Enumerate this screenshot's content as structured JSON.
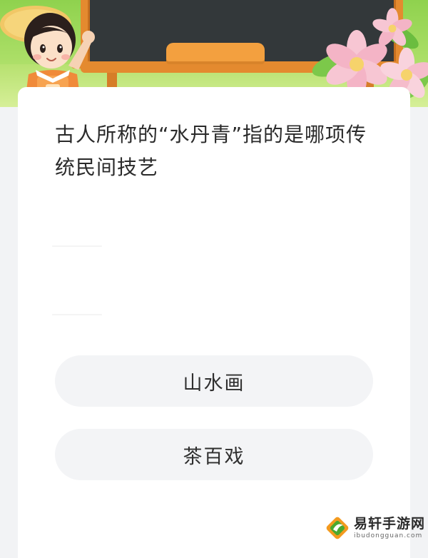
{
  "quiz": {
    "question": "古人所称的“水丹青”指的是哪项传统民间技艺",
    "options": [
      {
        "label": "山水画"
      },
      {
        "label": "茶百戏"
      }
    ]
  },
  "watermark": {
    "name": "易轩手游网",
    "domain": "ibudongguan.com",
    "logo_icon": "leaf-diamond-logo"
  },
  "colors": {
    "header_green": "#8fd24e",
    "board_frame": "#e48a2f",
    "option_bg": "#f3f4f6",
    "text": "#2a2a2a"
  }
}
